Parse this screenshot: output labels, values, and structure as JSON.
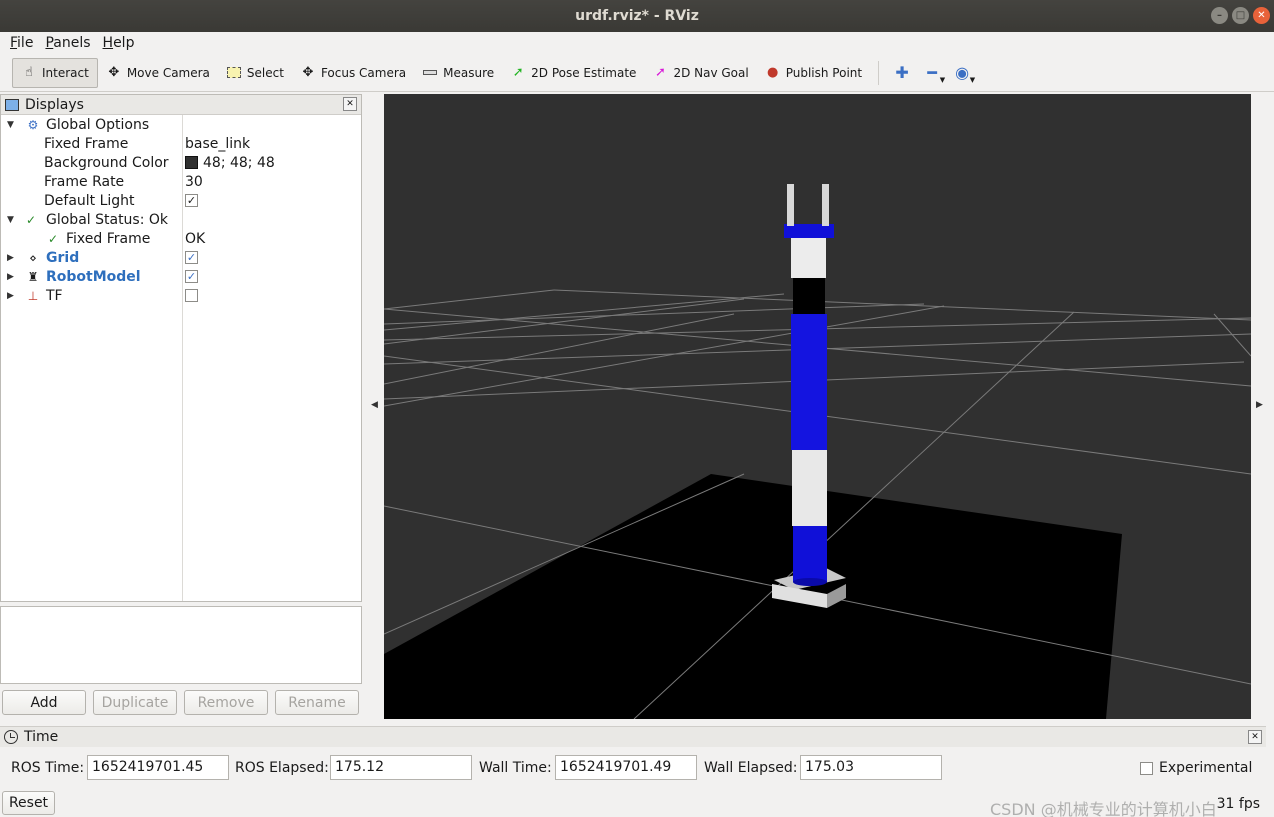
{
  "window": {
    "title": "urdf.rviz* - RViz"
  },
  "menu": [
    {
      "mnemonic": "F",
      "rest": "ile"
    },
    {
      "mnemonic": "P",
      "rest": "anels"
    },
    {
      "mnemonic": "H",
      "rest": "elp"
    }
  ],
  "toolbar": {
    "interact": "Interact",
    "move_camera": "Move Camera",
    "select": "Select",
    "focus_camera": "Focus Camera",
    "measure": "Measure",
    "pose_estimate": "2D Pose Estimate",
    "nav_goal": "2D Nav Goal",
    "publish_point": "Publish Point"
  },
  "displays": {
    "title": "Displays",
    "global_options": "Global Options",
    "fixed_frame_label": "Fixed Frame",
    "fixed_frame_value": "base_link",
    "bg_color_label": "Background Color",
    "bg_color_value": "48; 48; 48",
    "frame_rate_label": "Frame Rate",
    "frame_rate_value": "30",
    "default_light_label": "Default Light",
    "global_status": "Global Status: Ok",
    "status_fixed_frame": "Fixed Frame",
    "status_ok": "OK",
    "grid": "Grid",
    "robot_model": "RobotModel",
    "tf": "TF",
    "checks": {
      "default_light": true,
      "grid": true,
      "robot_model": true,
      "tf": false
    },
    "background_color_hex": "#303030"
  },
  "buttons": {
    "add": "Add",
    "duplicate": "Duplicate",
    "remove": "Remove",
    "rename": "Rename"
  },
  "time": {
    "title": "Time",
    "ros_time_label": "ROS Time:",
    "ros_time": "1652419701.45",
    "ros_elapsed_label": "ROS Elapsed:",
    "ros_elapsed": "175.12",
    "wall_time_label": "Wall Time:",
    "wall_time": "1652419701.49",
    "wall_elapsed_label": "Wall Elapsed:",
    "wall_elapsed": "175.03",
    "experimental": "Experimental"
  },
  "status": {
    "reset": "Reset",
    "fps": "31 fps"
  },
  "watermark": "CSDN @机械专业的计算机小白",
  "colors": {
    "robot_blue": "#1010d8",
    "robot_white": "#e6e6e6",
    "robot_black": "#000000"
  }
}
